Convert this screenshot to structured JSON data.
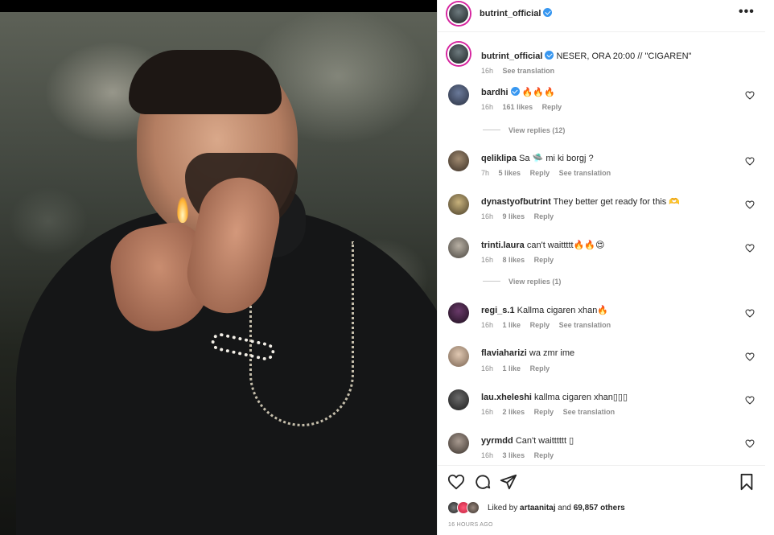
{
  "post": {
    "username": "butrint_official",
    "more_label": "•••"
  },
  "caption": {
    "username": "butrint_official",
    "text": "NESER, ORA 20:00 // \"CIGAREN\"",
    "time": "16h",
    "translation": "See translation"
  },
  "comments": [
    {
      "username": "bardhi",
      "verified": true,
      "text": "🔥🔥🔥",
      "time": "16h",
      "likes": "161 likes",
      "reply": "Reply",
      "translation": "",
      "avatar_color": "#4a5670",
      "view_replies": "View replies (12)"
    },
    {
      "username": "qeliklipa",
      "verified": false,
      "text": "Sa 🛸 mi ki borgj ?",
      "time": "7h",
      "likes": "5 likes",
      "reply": "Reply",
      "translation": "See translation",
      "avatar_color": "#6b5a48",
      "view_replies": ""
    },
    {
      "username": "dynastyofbutrint",
      "verified": false,
      "text": "They better get ready for this 🫶",
      "time": "16h",
      "likes": "9 likes",
      "reply": "Reply",
      "translation": "",
      "avatar_color": "#8a7b56",
      "view_replies": ""
    },
    {
      "username": "trinti.laura",
      "verified": false,
      "text": "can't waittttt🔥🔥😍",
      "time": "16h",
      "likes": "8 likes",
      "reply": "Reply",
      "translation": "",
      "avatar_color": "#7e7a72",
      "view_replies": "View replies (1)"
    },
    {
      "username": "regi_s.1",
      "verified": false,
      "text": "Kallma cigaren xhan🔥",
      "time": "16h",
      "likes": "1 like",
      "reply": "Reply",
      "translation": "See translation",
      "avatar_color": "#3a1e3a",
      "view_replies": ""
    },
    {
      "username": "flaviaharizi",
      "verified": false,
      "text": "wa zmr ime",
      "time": "16h",
      "likes": "1 like",
      "reply": "Reply",
      "translation": "",
      "avatar_color": "#b9a08c",
      "view_replies": ""
    },
    {
      "username": "lau.xheleshi",
      "verified": false,
      "text": "kallma cigaren xhan▯▯▯",
      "time": "16h",
      "likes": "2 likes",
      "reply": "Reply",
      "translation": "See translation",
      "avatar_color": "#3b3b3b",
      "view_replies": ""
    },
    {
      "username": "yyrmdd",
      "verified": false,
      "text": "Can't waitttttt ▯",
      "time": "16h",
      "likes": "3 likes",
      "reply": "Reply",
      "translation": "",
      "avatar_color": "#6a5f58",
      "view_replies": ""
    }
  ],
  "likes_summary": {
    "prefix": "Liked by",
    "user": "artaanitaj",
    "connector": "and",
    "others": "69,857 others"
  },
  "time_ago": "16 HOURS AGO",
  "colors": {
    "verified": "#3897f0",
    "muted": "#8e8e8e",
    "text": "#262626"
  }
}
